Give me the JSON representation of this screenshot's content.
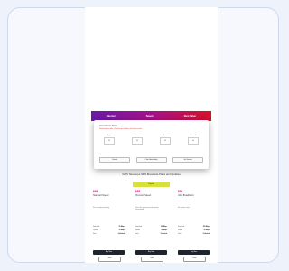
{
  "banner": {
    "items": [
      "Internet",
      "Speed",
      "Best Value"
    ]
  },
  "modal": {
    "title": "Countdown Timer",
    "subtitle": "Limited-time offer. Get the deal before the timer ends.",
    "countdown": [
      {
        "label": "Days",
        "value": "00"
      },
      {
        "label": "Hours",
        "value": "00"
      },
      {
        "label": "Minutes",
        "value": "00"
      },
      {
        "label": "Seconds",
        "value": "00"
      }
    ],
    "buttons": [
      "Details",
      "Check Availability",
      "Get Started"
    ]
  },
  "caption": "GWS Telecoupe NBN Broadside Plans and Updates",
  "plans": [
    {
      "price": "$69",
      "name": "Standard Speed",
      "desc": "For everyday browsing",
      "badge": "",
      "rows": [
        {
          "k": "Download",
          "v": "50 Mbps"
        },
        {
          "k": "Upload",
          "v": "20 Mbps"
        },
        {
          "k": "Data",
          "v": "Unlimited"
        }
      ],
      "buy": "Buy Now",
      "more": "More"
    },
    {
      "price": "$85",
      "name": "Premium Speed",
      "desc": "Great for streaming and gaming households",
      "badge": "Popular",
      "rows": [
        {
          "k": "Download",
          "v": "100 Mbps"
        },
        {
          "k": "Upload",
          "v": "40 Mbps"
        },
        {
          "k": "Data",
          "v": "Unlimited"
        }
      ],
      "buy": "Buy Now",
      "more": "More"
    },
    {
      "price": "$99",
      "name": "Ultra Broadband",
      "desc": "For power users",
      "badge": "",
      "rows": [
        {
          "k": "Download",
          "v": "250 Mbps"
        },
        {
          "k": "Upload",
          "v": "25 Mbps"
        },
        {
          "k": "Data",
          "v": "Unlimited"
        }
      ],
      "buy": "Buy Now",
      "more": "More"
    }
  ]
}
